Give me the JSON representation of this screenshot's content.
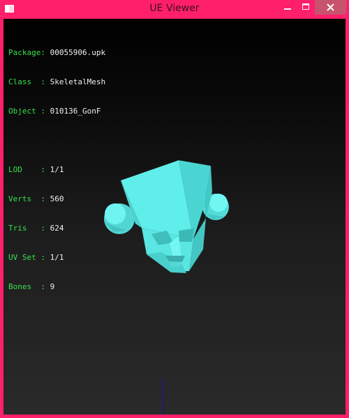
{
  "window": {
    "title": "UE Viewer",
    "controls": {
      "minimize": "minimize-icon",
      "maximize": "maximize-icon",
      "close": "close-icon"
    },
    "frame_color": "#ff1f6b"
  },
  "info": {
    "package_label": "Package:",
    "package_value": "00055906.upk",
    "class_label": "Class  :",
    "class_value": "SkeletalMesh",
    "object_label": "Object :",
    "object_value": "010136_GonF",
    "lod_label": "LOD    :",
    "lod_value": "1/1",
    "verts_label": "Verts  :",
    "verts_value": "560",
    "tris_label": "Tris   :",
    "tris_value": "624",
    "uvset_label": "UV Set :",
    "uvset_value": "1/1",
    "bones_label": "Bones  :",
    "bones_value": "9"
  },
  "colors": {
    "label_green": "#36e24a",
    "mesh_cyan": "#5ff3ef",
    "axis_blue": "#1010c8"
  }
}
